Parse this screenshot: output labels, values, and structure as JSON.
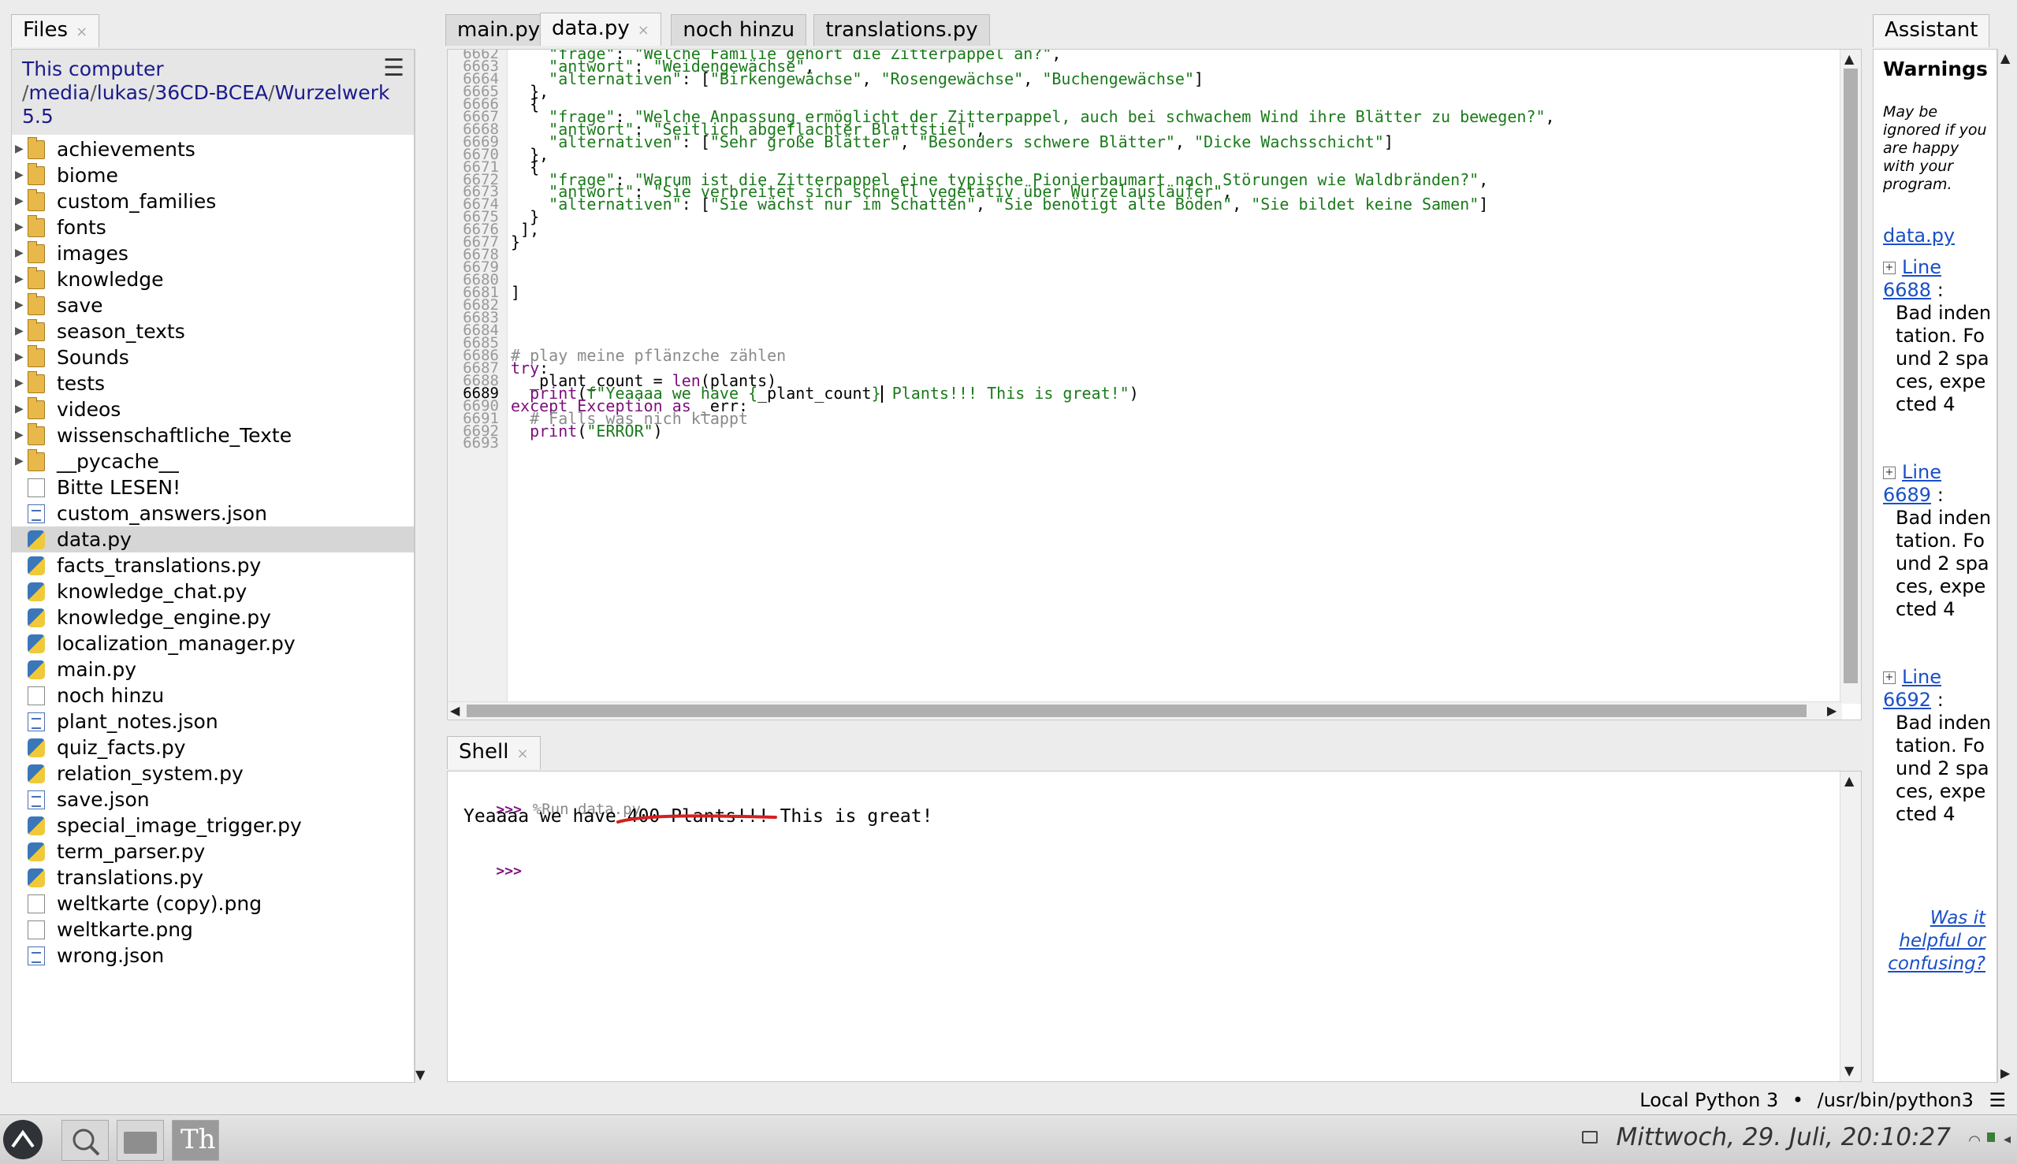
{
  "files": {
    "tab_label": "Files",
    "this_computer": "This computer",
    "path": [
      "media",
      "lukas",
      "36CD-BCEA",
      "Wurzelwerk 5.5"
    ],
    "items": [
      {
        "name": "achievements",
        "type": "folder"
      },
      {
        "name": "biome",
        "type": "folder"
      },
      {
        "name": "custom_families",
        "type": "folder"
      },
      {
        "name": "fonts",
        "type": "folder"
      },
      {
        "name": "images",
        "type": "folder"
      },
      {
        "name": "knowledge",
        "type": "folder"
      },
      {
        "name": "save",
        "type": "folder"
      },
      {
        "name": "season_texts",
        "type": "folder"
      },
      {
        "name": "Sounds",
        "type": "folder"
      },
      {
        "name": "tests",
        "type": "folder"
      },
      {
        "name": "videos",
        "type": "folder"
      },
      {
        "name": "wissenschaftliche_Texte",
        "type": "folder"
      },
      {
        "name": "__pycache__",
        "type": "folder"
      },
      {
        "name": "Bitte LESEN!",
        "type": "file"
      },
      {
        "name": "custom_answers.json",
        "type": "json"
      },
      {
        "name": "data.py",
        "type": "py",
        "selected": true
      },
      {
        "name": "facts_translations.py",
        "type": "py"
      },
      {
        "name": "knowledge_chat.py",
        "type": "py"
      },
      {
        "name": "knowledge_engine.py",
        "type": "py"
      },
      {
        "name": "localization_manager.py",
        "type": "py"
      },
      {
        "name": "main.py",
        "type": "py"
      },
      {
        "name": "noch hinzu",
        "type": "file"
      },
      {
        "name": "plant_notes.json",
        "type": "json"
      },
      {
        "name": "quiz_facts.py",
        "type": "py"
      },
      {
        "name": "relation_system.py",
        "type": "py"
      },
      {
        "name": "save.json",
        "type": "json"
      },
      {
        "name": "special_image_trigger.py",
        "type": "py"
      },
      {
        "name": "term_parser.py",
        "type": "py"
      },
      {
        "name": "translations.py",
        "type": "py"
      },
      {
        "name": "weltkarte (copy).png",
        "type": "file"
      },
      {
        "name": "weltkarte.png",
        "type": "file"
      },
      {
        "name": "wrong.json",
        "type": "json"
      }
    ]
  },
  "editor": {
    "tabs": [
      {
        "label": "main.py",
        "active": false
      },
      {
        "label": "data.py",
        "active": true
      },
      {
        "label": "noch hinzu",
        "active": false
      },
      {
        "label": "translations.py",
        "active": false
      }
    ],
    "current_line": "6689",
    "lines": [
      {
        "n": "6662",
        "parts": [
          [
            "    ",
            ""
          ],
          [
            "\"frage\"",
            "str"
          ],
          [
            ": ",
            ""
          ],
          [
            "\"Welche Familie gehört die Zitterpappel an?\"",
            "str"
          ],
          [
            ",",
            ""
          ]
        ]
      },
      {
        "n": "6663",
        "parts": [
          [
            "    ",
            ""
          ],
          [
            "\"antwort\"",
            "str"
          ],
          [
            ": ",
            ""
          ],
          [
            "\"Weidengewächse\"",
            "str"
          ],
          [
            ",",
            ""
          ]
        ]
      },
      {
        "n": "6664",
        "parts": [
          [
            "    ",
            ""
          ],
          [
            "\"alternativen\"",
            "str"
          ],
          [
            ": [",
            ""
          ],
          [
            "\"Birkengewächse\"",
            "str"
          ],
          [
            ", ",
            ""
          ],
          [
            "\"Rosengewächse\"",
            "str"
          ],
          [
            ", ",
            ""
          ],
          [
            "\"Buchengewächse\"",
            "str"
          ],
          [
            "]",
            ""
          ]
        ]
      },
      {
        "n": "6665",
        "parts": [
          [
            "  },",
            ""
          ]
        ]
      },
      {
        "n": "6666",
        "parts": [
          [
            "  {",
            ""
          ]
        ]
      },
      {
        "n": "6667",
        "parts": [
          [
            "    ",
            ""
          ],
          [
            "\"frage\"",
            "str"
          ],
          [
            ": ",
            ""
          ],
          [
            "\"Welche Anpassung ermöglicht der Zitterpappel, auch bei schwachem Wind ihre Blätter zu bewegen?\"",
            "str"
          ],
          [
            ",",
            ""
          ]
        ]
      },
      {
        "n": "6668",
        "parts": [
          [
            "    ",
            ""
          ],
          [
            "\"antwort\"",
            "str"
          ],
          [
            ": ",
            ""
          ],
          [
            "\"Seitlich abgeflachter Blattstiel\"",
            "str"
          ],
          [
            ",",
            ""
          ]
        ]
      },
      {
        "n": "6669",
        "parts": [
          [
            "    ",
            ""
          ],
          [
            "\"alternativen\"",
            "str"
          ],
          [
            ": [",
            ""
          ],
          [
            "\"Sehr große Blätter\"",
            "str"
          ],
          [
            ", ",
            ""
          ],
          [
            "\"Besonders schwere Blätter\"",
            "str"
          ],
          [
            ", ",
            ""
          ],
          [
            "\"Dicke Wachsschicht\"",
            "str"
          ],
          [
            "]",
            ""
          ]
        ]
      },
      {
        "n": "6670",
        "parts": [
          [
            "  },",
            ""
          ]
        ]
      },
      {
        "n": "6671",
        "parts": [
          [
            "  {",
            ""
          ]
        ]
      },
      {
        "n": "6672",
        "parts": [
          [
            "    ",
            ""
          ],
          [
            "\"frage\"",
            "str"
          ],
          [
            ": ",
            ""
          ],
          [
            "\"Warum ist die Zitterpappel eine typische Pionierbaumart nach Störungen wie Waldbränden?\"",
            "str"
          ],
          [
            ",",
            ""
          ]
        ]
      },
      {
        "n": "6673",
        "parts": [
          [
            "    ",
            ""
          ],
          [
            "\"antwort\"",
            "str"
          ],
          [
            ": ",
            ""
          ],
          [
            "\"Sie verbreitet sich schnell vegetativ über Wurzelausläufer\"",
            "str"
          ],
          [
            ",",
            ""
          ]
        ]
      },
      {
        "n": "6674",
        "parts": [
          [
            "    ",
            ""
          ],
          [
            "\"alternativen\"",
            "str"
          ],
          [
            ": [",
            ""
          ],
          [
            "\"Sie wächst nur im Schatten\"",
            "str"
          ],
          [
            ", ",
            ""
          ],
          [
            "\"Sie benötigt alte Böden\"",
            "str"
          ],
          [
            ", ",
            ""
          ],
          [
            "\"Sie bildet keine Samen\"",
            "str"
          ],
          [
            "]",
            ""
          ]
        ]
      },
      {
        "n": "6675",
        "parts": [
          [
            "  }",
            ""
          ]
        ]
      },
      {
        "n": "6676",
        "parts": [
          [
            " ],",
            ""
          ]
        ]
      },
      {
        "n": "6677",
        "parts": [
          [
            "}",
            ""
          ]
        ]
      },
      {
        "n": "6678",
        "parts": []
      },
      {
        "n": "6679",
        "parts": []
      },
      {
        "n": "6680",
        "parts": []
      },
      {
        "n": "6681",
        "parts": [
          [
            "]",
            ""
          ]
        ]
      },
      {
        "n": "6682",
        "parts": []
      },
      {
        "n": "6683",
        "parts": []
      },
      {
        "n": "6684",
        "parts": []
      },
      {
        "n": "6685",
        "parts": []
      },
      {
        "n": "6686",
        "parts": [
          [
            "# play meine pflänzche zählen",
            "cm"
          ]
        ]
      },
      {
        "n": "6687",
        "parts": [
          [
            "try",
            "kw"
          ],
          [
            ":",
            ""
          ]
        ]
      },
      {
        "n": "6688",
        "parts": [
          [
            "  _plant_count = ",
            ""
          ],
          [
            "len",
            "kw"
          ],
          [
            "(plants)",
            ""
          ]
        ]
      },
      {
        "n": "6689",
        "parts": [
          [
            "  ",
            ""
          ],
          [
            "print",
            "kw"
          ],
          [
            "(",
            ""
          ],
          [
            "f\"Yeaaaa we have ",
            "str"
          ],
          [
            "{",
            "str"
          ],
          [
            "_plant_count",
            ""
          ],
          [
            "}",
            "str"
          ],
          [
            "|CURSOR|",
            ""
          ],
          [
            " Plants!!! This is great!\"",
            "str"
          ],
          [
            ")",
            ""
          ]
        ]
      },
      {
        "n": "6690",
        "parts": [
          [
            "except",
            "kw"
          ],
          [
            " ",
            ""
          ],
          [
            "Exception",
            "kw"
          ],
          [
            " ",
            ""
          ],
          [
            "as",
            "kw"
          ],
          [
            " _err:",
            ""
          ]
        ]
      },
      {
        "n": "6691",
        "parts": [
          [
            "  # Falls was nich klappt",
            "cm"
          ]
        ]
      },
      {
        "n": "6692",
        "parts": [
          [
            "  ",
            ""
          ],
          [
            "print",
            "kw"
          ],
          [
            "(",
            ""
          ],
          [
            "\"ERROR\"",
            "str"
          ],
          [
            ")",
            ""
          ]
        ]
      },
      {
        "n": "6693",
        "parts": []
      }
    ]
  },
  "shell": {
    "tab_label": "Shell",
    "prompt": ">>>",
    "run_command": "%Run data.py",
    "output_prefix": "Yeaaaa we have ",
    "output_highlight": "400 Plants!!!",
    "output_suffix": " This is great!",
    "annotation_color": "#d42020"
  },
  "assistant": {
    "tab_label": "Assistant",
    "title": "Warnings",
    "subtitle": "May be ignored if you are happy with your program.",
    "file": "data.py",
    "issues": [
      {
        "line": "Line 6688",
        "message": "Bad indentation. Found 2 spaces, expected 4"
      },
      {
        "line": "Line 6689",
        "message": "Bad indentation. Found 2 spaces, expected 4"
      },
      {
        "line": "Line 6692",
        "message": "Bad indentation. Found 2 spaces, expected 4"
      }
    ],
    "helpful": "Was it helpful or confusing?"
  },
  "status": {
    "interpreter": "Local Python 3",
    "separator": "•",
    "path": "/usr/bin/python3"
  },
  "taskbar": {
    "clock": "Mittwoch, 29. Juli, 20:10:27"
  },
  "colors": {
    "string": "#1a7a1a",
    "keyword": "#7b0e7b",
    "comment": "#8a8a8a",
    "link": "#1a4fc7"
  }
}
